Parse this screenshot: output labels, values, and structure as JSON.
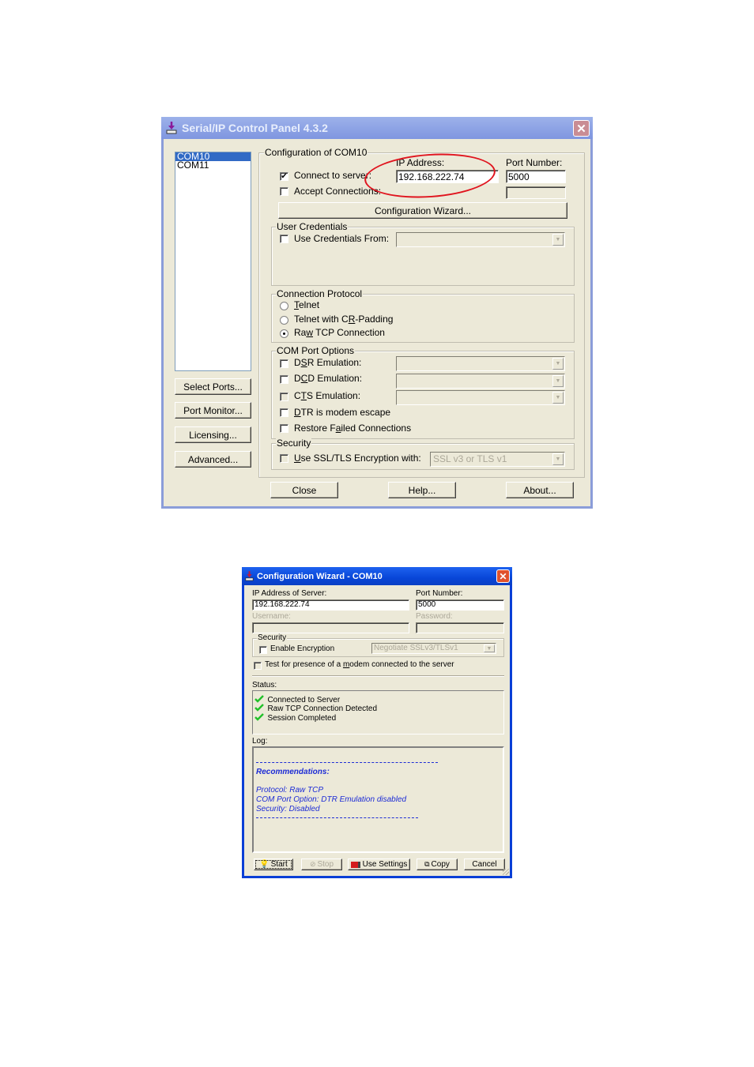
{
  "control_panel": {
    "title": "Serial/IP Control Panel 4.3.2",
    "ports": [
      "COM10",
      "COM11"
    ],
    "selected_port": "COM10",
    "left_buttons": [
      "Select Ports...",
      "Port Monitor...",
      "Licensing...",
      "Advanced..."
    ],
    "config_group_title": "Configuration of COM10",
    "ip_address_label": "IP Address:",
    "port_number_label": "Port Number:",
    "connect_to_server_label": "Connect to server:",
    "connect_to_server_checked": true,
    "accept_connections_label": "Accept Connections:",
    "accept_connections_checked": false,
    "ip_address_value": "192.168.222.74",
    "port_number_value": "5000",
    "accept_port_value": "",
    "config_wizard_button": "Configuration Wizard...",
    "user_credentials": {
      "title": "User Credentials",
      "use_credentials_label": "Use Credentials From:",
      "checked": false,
      "value": ""
    },
    "connection_protocol": {
      "title": "Connection Protocol",
      "options": [
        {
          "pre": "",
          "u": "T",
          "post": "elnet",
          "selected": false
        },
        {
          "pre": "Telnet with C",
          "u": "R",
          "post": "-Padding",
          "selected": false
        },
        {
          "pre": "Ra",
          "u": "w",
          "post": " TCP Connection",
          "selected": true
        }
      ]
    },
    "com_port_options": {
      "title": "COM Port Options",
      "dsr": {
        "pre": "D",
        "u": "S",
        "post": "R Emulation:",
        "checked": false,
        "value": ""
      },
      "dcd": {
        "pre": "D",
        "u": "C",
        "post": "D Emulation:",
        "checked": false,
        "value": ""
      },
      "cts": {
        "pre": "C",
        "u": "T",
        "post": "S Emulation:",
        "checked": false,
        "value": ""
      },
      "dtr": {
        "pre": "",
        "u": "D",
        "post": "TR is modem escape",
        "checked": false
      },
      "restore": {
        "pre": "Restore F",
        "u": "a",
        "post": "iled Connections",
        "checked": false
      }
    },
    "security": {
      "title": "Security",
      "ssl": {
        "pre": "",
        "u": "U",
        "post": "se SSL/TLS Encryption with:",
        "checked": false,
        "value": "SSL v3 or TLS v1"
      }
    },
    "bottom_buttons": {
      "close": "Close",
      "help": "Help...",
      "about": "About..."
    },
    "annotation_color": "#e0141e"
  },
  "wizard": {
    "title": "Configuration Wizard - COM10",
    "ip_label": "IP Address of Server:",
    "ip_value": "192.168.222.74",
    "port_label": "Port Number:",
    "port_value": "5000",
    "username_label": "Username:",
    "username_value": "",
    "password_label": "Password:",
    "password_value": "",
    "security_title": "Security",
    "enable_encryption_label": "Enable Encryption",
    "enable_encryption_checked": false,
    "encryption_value": "Negotiate SSLv3/TLSv1",
    "modem_test": {
      "pre": "Test for presence of a ",
      "u": "m",
      "post": "odem connected to the server",
      "checked": false
    },
    "status_label": "Status:",
    "status_items": [
      "Connected to Server",
      "Raw TCP Connection Detected",
      "Session Completed"
    ],
    "log_label": "Log:",
    "log": {
      "heading": "Recommendations:",
      "lines": [
        "Protocol: Raw TCP",
        "COM Port Option: DTR Emulation disabled",
        "Security: Disabled"
      ]
    },
    "buttons": {
      "start": "Start",
      "stop": "Stop",
      "use_settings": "Use Settings",
      "copy": "Copy",
      "cancel": "Cancel"
    },
    "status_icon": "green-checkmark",
    "log_color": "#1c2bd6"
  }
}
